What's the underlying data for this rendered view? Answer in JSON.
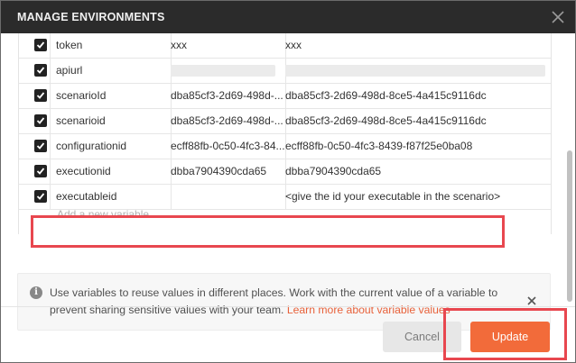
{
  "modal": {
    "title": "MANAGE ENVIRONMENTS",
    "close_icon": "close-icon"
  },
  "variables": [
    {
      "checked": true,
      "key": "token",
      "initial": "xxx",
      "current": "xxx"
    },
    {
      "checked": true,
      "key": "apiurl",
      "initial": "",
      "current": "",
      "redacted": true
    },
    {
      "checked": true,
      "key": "scenarioId",
      "initial": "dba85cf3-2d69-498d-...",
      "current": "dba85cf3-2d69-498d-8ce5-4a415c9116dc"
    },
    {
      "checked": true,
      "key": "scenarioid",
      "initial": "dba85cf3-2d69-498d-...",
      "current": "dba85cf3-2d69-498d-8ce5-4a415c9116dc"
    },
    {
      "checked": true,
      "key": "configurationid",
      "initial": "ecff88fb-0c50-4fc3-84...",
      "current": "ecff88fb-0c50-4fc3-8439-f87f25e0ba08"
    },
    {
      "checked": true,
      "key": "executionid",
      "initial": "dbba7904390cda65",
      "current": "dbba7904390cda65"
    },
    {
      "checked": true,
      "key": "executableid",
      "initial": "",
      "current": "<give the id your executable in the scenario>"
    }
  ],
  "add_variable_placeholder": "Add a new variable",
  "info": {
    "text": "Use variables to reuse values in different places. Work with the current value of a variable to prevent sharing sensitive values with your team.",
    "link": "Learn more about variable values",
    "icon": "info-icon"
  },
  "footer": {
    "cancel_label": "Cancel",
    "update_label": "Update"
  },
  "colors": {
    "header_bg": "#2b2b2b",
    "accent": "#f26b3a",
    "highlight": "#e8474f",
    "link": "#e8623b"
  }
}
